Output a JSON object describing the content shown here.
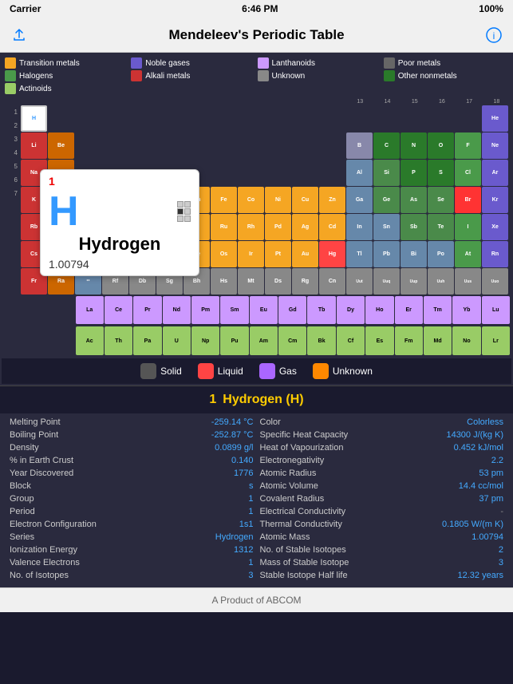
{
  "statusBar": {
    "carrier": "Carrier",
    "wifi": "📶",
    "time": "6:46 PM",
    "battery": "100%"
  },
  "navBar": {
    "title": "Mendeleev's Periodic Table"
  },
  "legend": [
    {
      "id": "transition",
      "label": "Transition metals",
      "color": "#f5a623"
    },
    {
      "id": "noble",
      "label": "Noble gases",
      "color": "#6a5acd"
    },
    {
      "id": "lanthanoids",
      "label": "Lanthanoids",
      "color": "#cc99ff"
    },
    {
      "id": "poor",
      "label": "Poor metals",
      "color": "#666666"
    },
    {
      "id": "halogens",
      "label": "Halogens",
      "color": "#4a9a4a"
    },
    {
      "id": "alkali",
      "label": "Alkali metals",
      "color": "#cc3333"
    },
    {
      "id": "unknown",
      "label": "Unknown",
      "color": "#888888"
    },
    {
      "id": "other-nonmetal",
      "label": "Other nonmetals",
      "color": "#2a7a2a"
    },
    {
      "id": "actinoids",
      "label": "Actinoids",
      "color": "#99cc66"
    }
  ],
  "popup": {
    "atomicNumber": "1",
    "symbol": "H",
    "name": "Hydrogen",
    "mass": "1.00794"
  },
  "stateItems": [
    {
      "id": "solid",
      "label": "Solid",
      "color": "#555555"
    },
    {
      "id": "liquid",
      "label": "Liquid",
      "color": "#ff4444"
    },
    {
      "id": "gas",
      "label": "Gas",
      "color": "#aa66ff"
    },
    {
      "id": "unknown",
      "label": "Unknown",
      "color": "#ff8800"
    }
  ],
  "infoHeader": {
    "number": "1",
    "name": "Hydrogen (H)"
  },
  "infoLeft": [
    {
      "label": "Melting Point",
      "value": "-259.14 °C"
    },
    {
      "label": "Boiling Point",
      "value": "-252.87 °C"
    },
    {
      "label": "Density",
      "value": "0.0899 g/l"
    },
    {
      "label": "% in Earth Crust",
      "value": "0.140"
    },
    {
      "label": "Year Discovered",
      "value": "1776"
    },
    {
      "label": "Block",
      "value": "s"
    },
    {
      "label": "Group",
      "value": "1"
    },
    {
      "label": "Period",
      "value": "1"
    },
    {
      "label": "Electron Configuration",
      "value": "1s1"
    },
    {
      "label": "Series",
      "value": "Hydrogen"
    },
    {
      "label": "Ionization Energy",
      "value": "1312"
    },
    {
      "label": "Valence Electrons",
      "value": "1"
    },
    {
      "label": "No. of Isotopes",
      "value": "3"
    }
  ],
  "infoRight": [
    {
      "label": "Color",
      "value": "Colorless"
    },
    {
      "label": "Specific Heat Capacity",
      "value": "14300 J/(kg K)"
    },
    {
      "label": "Heat of Vapourization",
      "value": "0.452 kJ/mol"
    },
    {
      "label": "Electronegativity",
      "value": "2.2"
    },
    {
      "label": "Atomic Radius",
      "value": "53 pm"
    },
    {
      "label": "Atomic Volume",
      "value": "14.4 cc/mol"
    },
    {
      "label": "Covalent Radius",
      "value": "37 pm"
    },
    {
      "label": "Electrical Conductivity",
      "value": "-"
    },
    {
      "label": "Thermal Conductivity",
      "value": "0.1805 W/(m K)"
    },
    {
      "label": "Atomic Mass",
      "value": "1.00794"
    },
    {
      "label": "No. of Stable Isotopes",
      "value": "2"
    },
    {
      "label": "Mass of Stable Isotope",
      "value": "3"
    },
    {
      "label": "Stable Isotope Half life",
      "value": "12.32 years"
    }
  ],
  "footer": {
    "text": "A Product of ABCOM"
  }
}
